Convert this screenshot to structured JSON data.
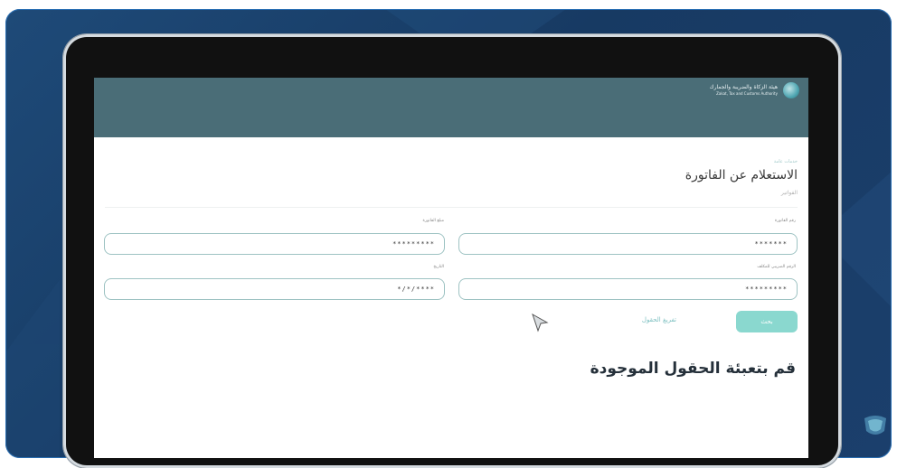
{
  "header": {
    "org_name_ar": "هيئة الزكاة والضريبة والجمارك",
    "org_name_en": "Zakat, Tax and Customs Authority"
  },
  "page": {
    "breadcrumb": "خدمات عامة",
    "title": "الاستعلام عن الفاتورة",
    "subtitle": "الفواتير"
  },
  "form": {
    "invoice_number_label": "رقم الفاتورة",
    "invoice_number_value": "*******",
    "invoice_amount_label": "مبلغ الفاتورة",
    "invoice_amount_value": "*********",
    "vat_number_label": "الرقم الضريبي للمكلف",
    "vat_number_value": "*********",
    "date_label": "التاريخ",
    "date_value": "*/*/****"
  },
  "actions": {
    "search_label": "بحث",
    "clear_label": "تفريغ الحقول"
  },
  "overlay": {
    "instruction": "قم بتعبئة الحقول الموجودة"
  },
  "colors": {
    "header_bg": "#4a6d77",
    "accent": "#8ad8cf",
    "frame_bg": "#173a63"
  }
}
